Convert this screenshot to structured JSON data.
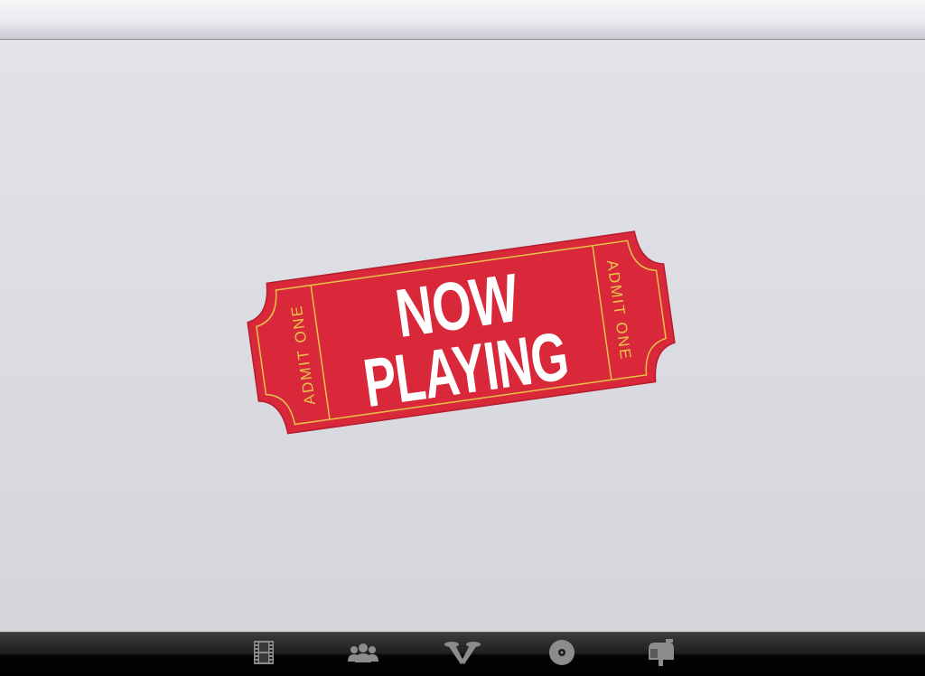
{
  "ticket": {
    "line1": "NOW",
    "line2": "PLAYING",
    "stub_left": "ADMIT ONE",
    "stub_right": "ADMIT ONE"
  },
  "colors": {
    "ticket_red": "#d8283a",
    "ticket_gold": "#e8c34a",
    "ticket_text": "#ffffff",
    "tab_icon": "#8c8c8c"
  },
  "tabs": [
    {
      "icon": "film-strip-icon",
      "name": "tab-movies"
    },
    {
      "icon": "people-icon",
      "name": "tab-people"
    },
    {
      "icon": "searchlights-icon",
      "name": "tab-premieres"
    },
    {
      "icon": "disc-icon",
      "name": "tab-dvd"
    },
    {
      "icon": "mailbox-icon",
      "name": "tab-mailbox"
    }
  ]
}
